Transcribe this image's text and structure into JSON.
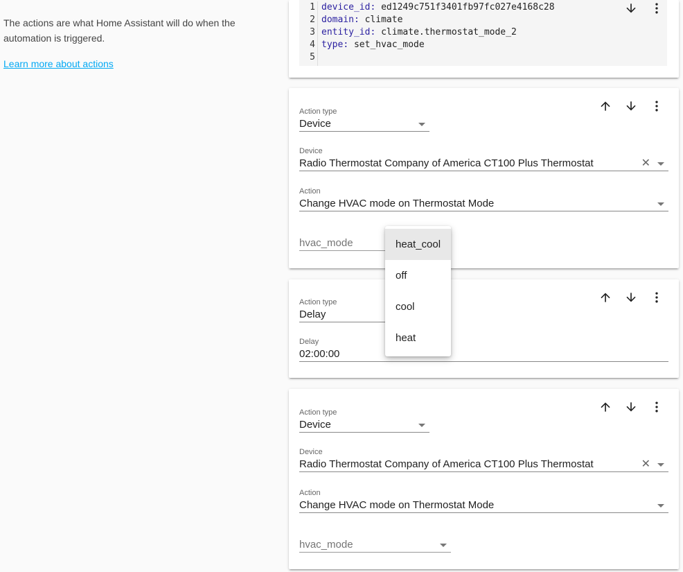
{
  "intro": {
    "description": "The actions are what Home Assistant will do when the automation is triggered.",
    "link": "Learn more about actions"
  },
  "code_card": {
    "line_numbers": [
      "1",
      "2",
      "3",
      "4",
      "5"
    ],
    "lines": [
      {
        "key": "device_id",
        "value": "ed1249c751f3401fb97fc027e4168c28"
      },
      {
        "key": "domain",
        "value": "climate"
      },
      {
        "key": "entity_id",
        "value": "climate.thermostat_mode_2"
      },
      {
        "key": "type",
        "value": "set_hvac_mode"
      }
    ]
  },
  "action1": {
    "action_type_label": "Action type",
    "action_type_value": "Device",
    "device_label": "Device",
    "device_value": "Radio Thermostat Company of America CT100 Plus Thermostat",
    "action_label": "Action",
    "action_value": "Change HVAC mode on Thermostat Mode",
    "hvac_placeholder": "hvac_mode"
  },
  "action2": {
    "action_type_label": "Action type",
    "action_type_value": "Delay",
    "delay_label": "Delay",
    "delay_value": "02:00:00"
  },
  "action3": {
    "action_type_label": "Action type",
    "action_type_value": "Device",
    "device_label": "Device",
    "device_value": "Radio Thermostat Company of America CT100 Plus Thermostat",
    "action_label": "Action",
    "action_value": "Change HVAC mode on Thermostat Mode",
    "hvac_placeholder": "hvac_mode"
  },
  "dropdown": {
    "options": [
      "heat_cool",
      "off",
      "cool",
      "heat"
    ],
    "highlighted": "heat_cool"
  },
  "icons": {
    "up": "arrow-up-icon",
    "down": "arrow-down-icon",
    "more": "more-vertical-icon",
    "clear": "close-icon",
    "caret": "caret-down-icon"
  }
}
